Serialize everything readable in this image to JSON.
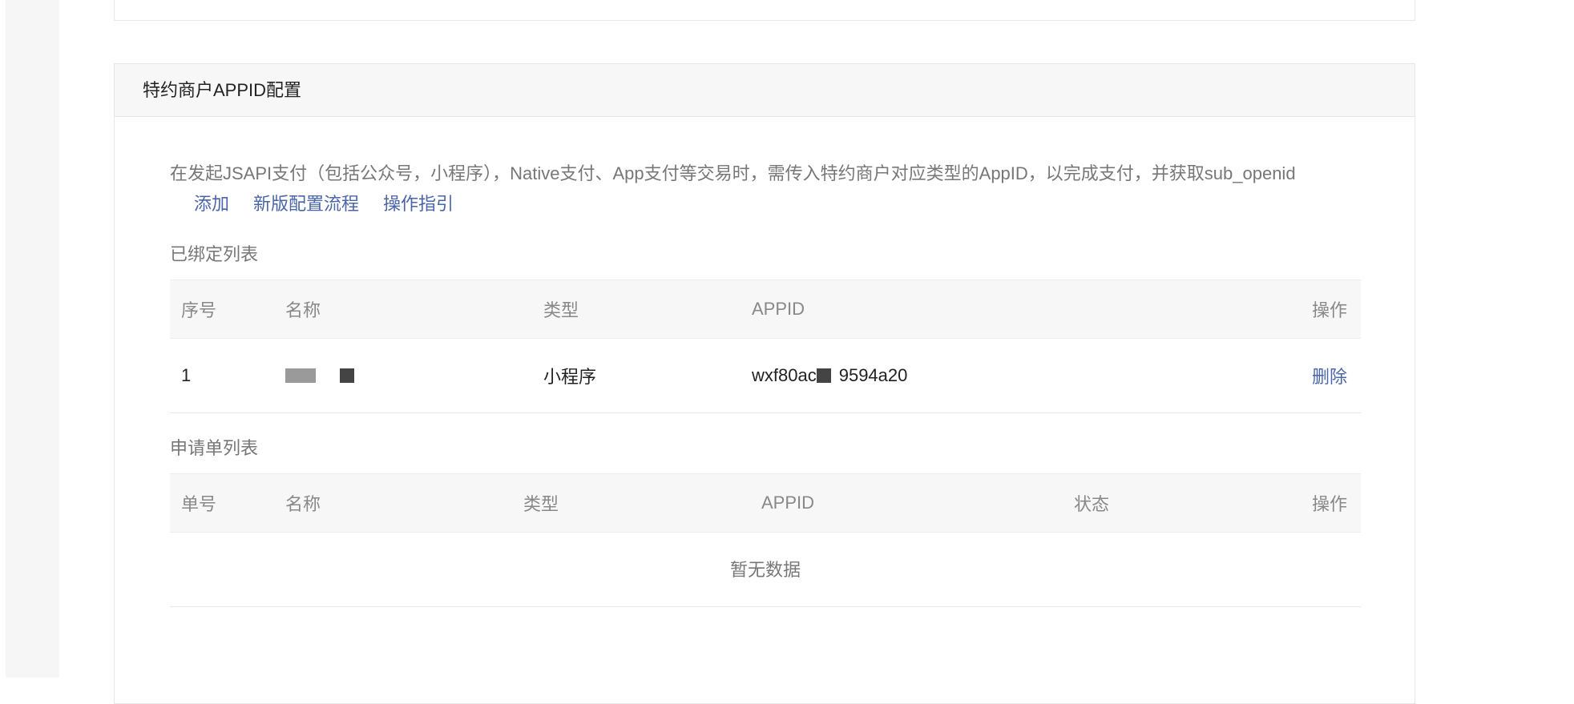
{
  "section": {
    "title": "特约商户APPID配置",
    "description": "在发起JSAPI支付（包括公众号，小程序），Native支付、App支付等交易时，需传入特约商户对应类型的AppID，以完成支付，并获取sub_openid",
    "links": {
      "add": "添加",
      "new_flow": "新版配置流程",
      "guide": "操作指引"
    }
  },
  "bound_list": {
    "title": "已绑定列表",
    "columns": [
      "序号",
      "名称",
      "类型",
      "APPID",
      "操作"
    ],
    "rows": [
      {
        "index": "1",
        "name": "",
        "type": "小程序",
        "appid_prefix": "wxf80ac",
        "appid_suffix": "9594a20",
        "action": "删除"
      }
    ]
  },
  "application_list": {
    "title": "申请单列表",
    "columns": [
      "单号",
      "名称",
      "类型",
      "APPID",
      "状态",
      "操作"
    ],
    "empty_text": "暂无数据"
  },
  "colors": {
    "link": "#4a66a8",
    "header_bg": "#f7f7f7",
    "border": "#e6e6e6"
  }
}
